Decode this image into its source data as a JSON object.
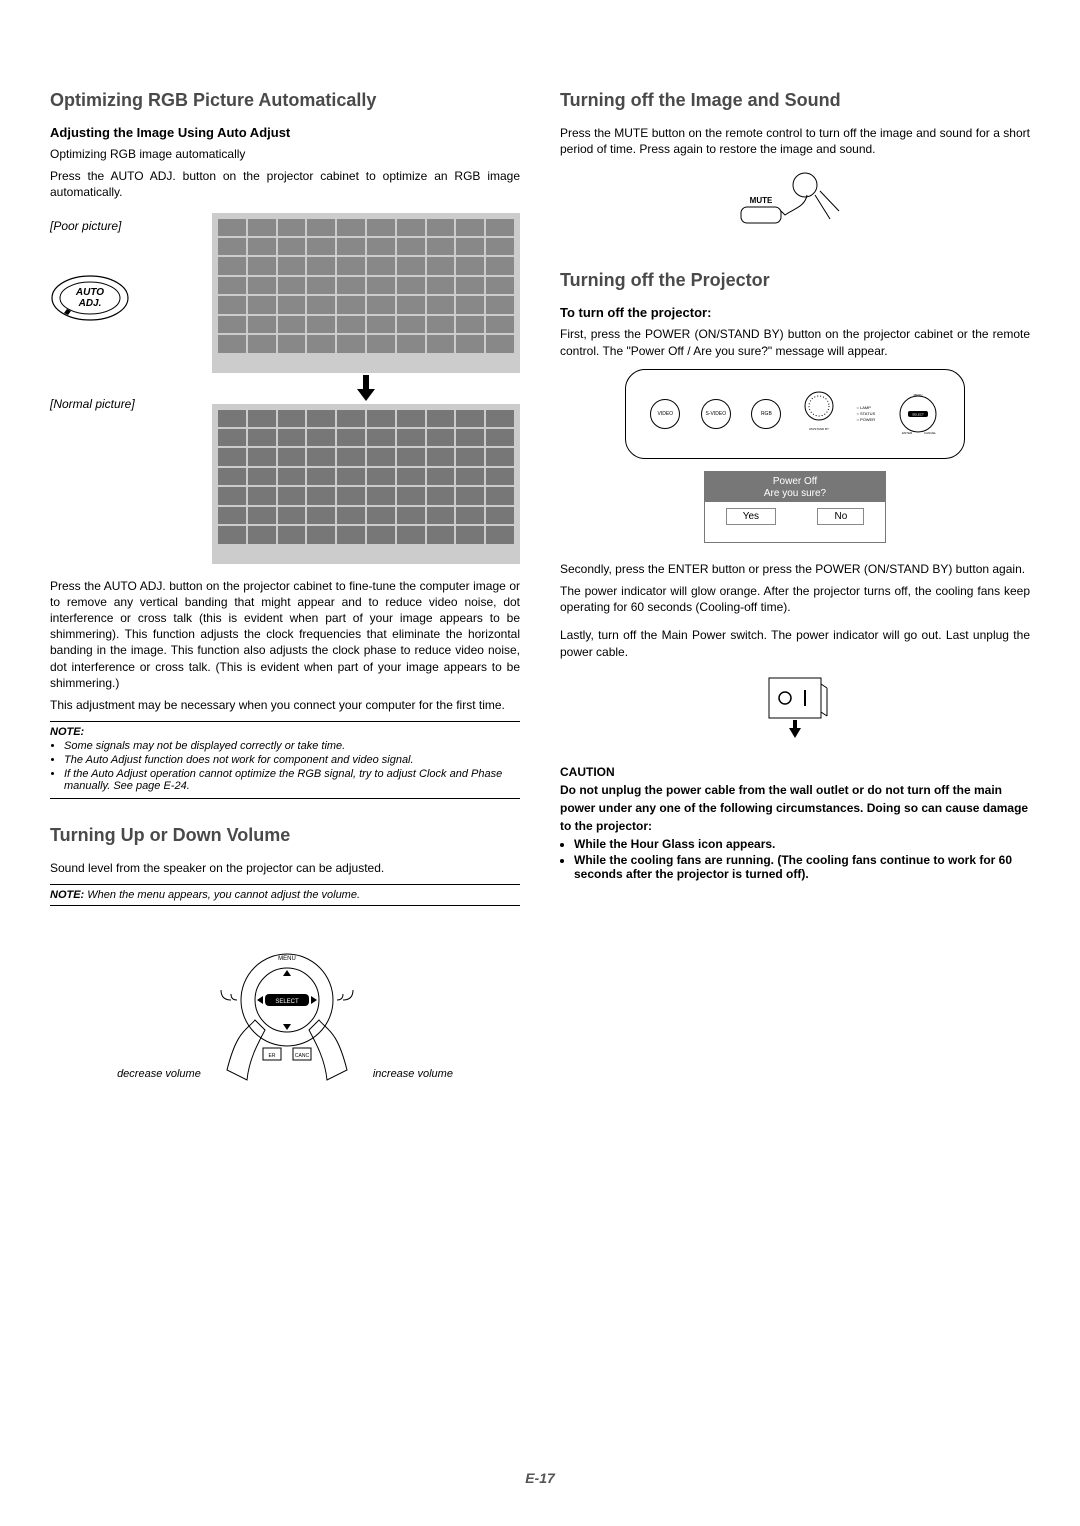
{
  "left": {
    "h1": "Optimizing RGB Picture Automatically",
    "h1_sub": "Adjusting the Image Using Auto Adjust",
    "p1": "Optimizing RGB image automatically",
    "p2": "Press the AUTO ADJ. button on the projector cabinet to optimize an RGB image automatically.",
    "poor_label": "[Poor picture]",
    "normal_label": "[Normal picture]",
    "auto_btn": "AUTO ADJ.",
    "p3": "Press the AUTO ADJ. button on the projector cabinet to fine-tune the computer image or to remove any vertical banding that might appear and to reduce video noise, dot interference or cross talk (this is evident when part of your image appears to be shimmering). This function adjusts the clock frequencies that eliminate the horizontal banding in the image. This function also adjusts the clock phase to reduce video noise, dot interference or cross talk. (This is evident when part of your image appears to be shimmering.)",
    "p4": "This adjustment may be necessary when you connect your computer for the first time.",
    "note_title": "NOTE:",
    "note_items": [
      "Some signals may not be displayed correctly or take time.",
      "The Auto Adjust function does not work for component and video signal.",
      "If the Auto Adjust operation cannot optimize the RGB signal, try to adjust Clock and Phase manually. See page E-24."
    ],
    "h2": "Turning Up or Down Volume",
    "p5": "Sound level from the speaker on the projector can be adjusted.",
    "note2_title": "NOTE:",
    "note2_body": "When the menu appears, you cannot adjust the volume.",
    "vol_dec": "decrease volume",
    "vol_inc": "increase volume",
    "vol_menu": "MENU",
    "vol_select": "SELECT",
    "vol_er": "ER",
    "vol_canc": "CANC"
  },
  "right": {
    "h1": "Turning off the Image and Sound",
    "p1": "Press the MUTE button on the remote control to turn off the image and sound for a short period of time. Press again to restore the image and sound.",
    "mute_label": "MUTE",
    "h2": "Turning off the Projector",
    "h2_sub": "To turn off the projector:",
    "p2": "First, press the POWER (ON/STAND BY) button on the projector cabinet or the remote control. The \"Power Off / Are you sure?\" message will appear.",
    "panel": {
      "video": "VIDEO",
      "svideo": "S-VIDEO",
      "rgb": "RGB",
      "lamp": "LAMP",
      "status": "STATUS",
      "power": "POWER",
      "onstand": "ON/STAND BY",
      "menu": "MENU",
      "select": "SELECT",
      "enter": "ENTER",
      "cancel": "CANCEL"
    },
    "dialog": {
      "line1": "Power Off",
      "line2": "Are you sure?",
      "yes": "Yes",
      "no": "No"
    },
    "p3": "Secondly, press the ENTER button or press the POWER (ON/STAND BY) button again.",
    "p4": "The power indicator will glow orange. After the projector turns off, the cooling fans keep operating for 60 seconds (Cooling-off time).",
    "p5": "Lastly, turn off the Main Power switch. The power indicator will go out. Last unplug the power cable.",
    "caution_title": "CAUTION",
    "caution_p": "Do not unplug the power cable from the wall outlet or do not turn off the main power under any one of the following circumstances. Doing so can cause damage to the projector:",
    "caution_items": [
      "While the Hour Glass icon appears.",
      "While the cooling fans are running. (The cooling fans continue to work for 60 seconds after the projector is turned off)."
    ]
  },
  "page_num": "E-17"
}
